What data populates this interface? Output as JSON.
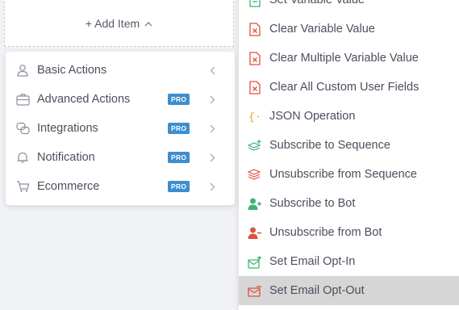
{
  "add_item": {
    "label": "+ Add Item"
  },
  "left_menu": {
    "items": [
      {
        "label": "Basic Actions",
        "pro": ""
      },
      {
        "label": "Advanced Actions",
        "pro": "PRO"
      },
      {
        "label": "Integrations",
        "pro": "PRO"
      },
      {
        "label": "Notification",
        "pro": "PRO"
      },
      {
        "label": "Ecommerce",
        "pro": "PRO"
      }
    ]
  },
  "right_menu": {
    "items": [
      {
        "label": "Set Variable Value",
        "icon": "set-variable-icon"
      },
      {
        "label": "Clear Variable Value",
        "icon": "clear-variable-icon"
      },
      {
        "label": "Clear Multiple Variable Value",
        "icon": "clear-multiple-variable-icon"
      },
      {
        "label": "Clear All Custom User Fields",
        "icon": "clear-custom-fields-icon"
      },
      {
        "label": "JSON Operation",
        "icon": "json-braces-icon"
      },
      {
        "label": "Subscribe to Sequence",
        "icon": "subscribe-sequence-icon"
      },
      {
        "label": "Unsubscribe from Sequence",
        "icon": "unsubscribe-sequence-icon"
      },
      {
        "label": "Subscribe to Bot",
        "icon": "subscribe-bot-icon"
      },
      {
        "label": "Unsubscribe from Bot",
        "icon": "unsubscribe-bot-icon"
      },
      {
        "label": "Set Email Opt-In",
        "icon": "email-opt-in-icon"
      },
      {
        "label": "Set Email Opt-Out",
        "icon": "email-opt-out-icon"
      }
    ]
  },
  "colors": {
    "red": "#e0523d",
    "green": "#3cb371",
    "orange": "#f2a31b",
    "pro_badge": "#3d8ed0",
    "gray_icon": "#8a8f9c",
    "hover_bg": "#d6d6d6"
  }
}
